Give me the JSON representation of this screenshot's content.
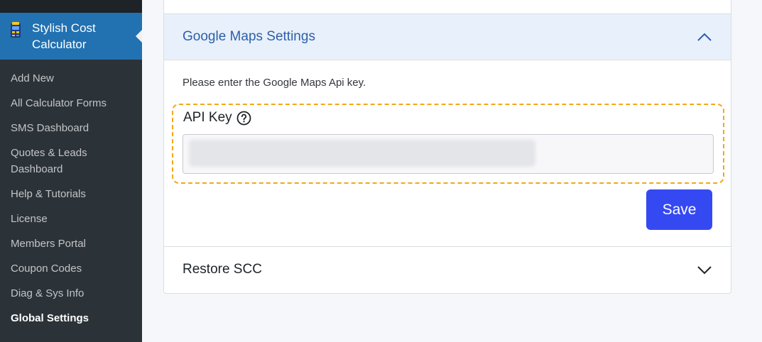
{
  "sidebar": {
    "plugin_label": "Stylish Cost Calculator",
    "plugin_icon": "calculator-icon",
    "items": [
      {
        "label": "Add New",
        "current": false
      },
      {
        "label": "All Calculator Forms",
        "current": false
      },
      {
        "label": "SMS Dashboard",
        "current": false
      },
      {
        "label": "Quotes & Leads Dashboard",
        "current": false
      },
      {
        "label": "Help & Tutorials",
        "current": false
      },
      {
        "label": "License",
        "current": false
      },
      {
        "label": "Members Portal",
        "current": false
      },
      {
        "label": "Coupon Codes",
        "current": false
      },
      {
        "label": "Diag & Sys Info",
        "current": false
      },
      {
        "label": "Global Settings",
        "current": true
      }
    ]
  },
  "maps_section": {
    "title": "Google Maps Settings",
    "toggle_icon": "chevron-up-icon",
    "help_text": "Please enter the Google Maps Api key.",
    "field_label": "API Key",
    "field_help_icon": "question-circle-icon",
    "api_key_value": "",
    "save_label": "Save"
  },
  "restore_section": {
    "title": "Restore SCC",
    "toggle_icon": "chevron-down-icon"
  },
  "colors": {
    "sidebar_bg": "#2c3338",
    "sidebar_active": "#2271b1",
    "header_bg": "#e8f0fb",
    "title_blue": "#2d5fa8",
    "save_button": "#3549f2",
    "highlight_border": "#f2a818"
  }
}
